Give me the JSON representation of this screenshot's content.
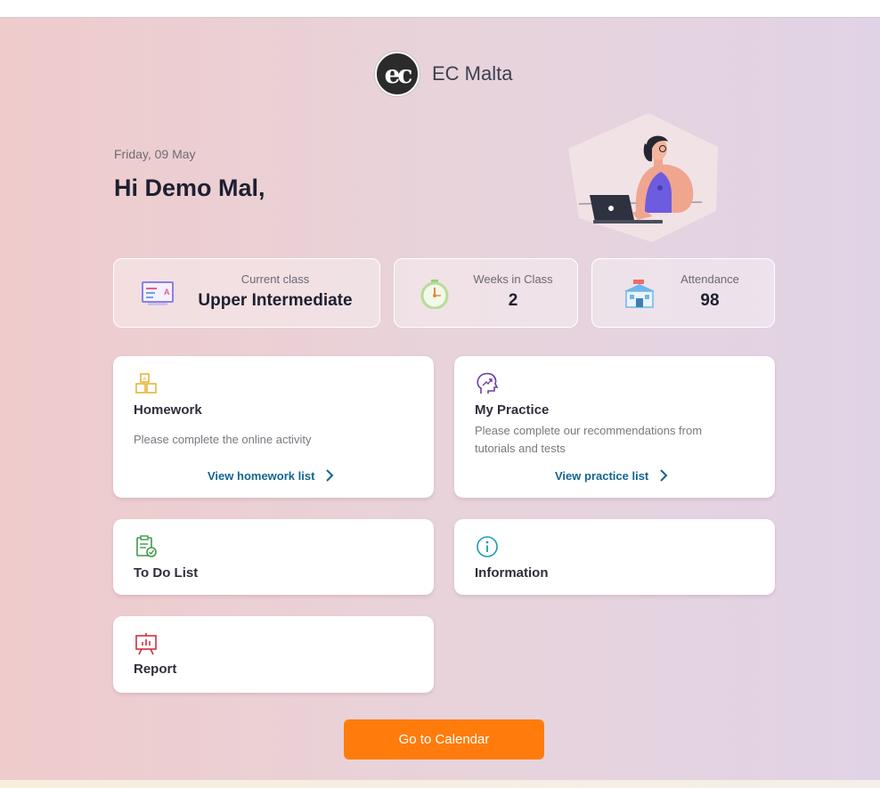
{
  "brand": {
    "name": "EC Malta",
    "logo_text": "ec"
  },
  "header": {
    "date": "Friday, 09 May",
    "greeting": "Hi Demo Mal,"
  },
  "stats": {
    "current_class": {
      "label": "Current class",
      "value": "Upper Intermediate",
      "icon": "classroom-board-icon"
    },
    "weeks": {
      "label": "Weeks in Class",
      "value": "2",
      "icon": "stopwatch-icon"
    },
    "attendance": {
      "label": "Attendance",
      "value": "98",
      "icon": "school-building-icon"
    }
  },
  "tiles": {
    "homework": {
      "title": "Homework",
      "description": "Please complete the online activity",
      "link": "View homework list",
      "icon": "blocks-icon"
    },
    "practice": {
      "title": "My Practice",
      "description": "Please complete our recommendations from tutorials and tests",
      "link": "View practice list",
      "icon": "head-growth-icon"
    },
    "todo": {
      "title": "To Do List",
      "icon": "clipboard-check-icon"
    },
    "information": {
      "title": "Information",
      "icon": "info-circle-icon"
    },
    "report": {
      "title": "Report",
      "icon": "presentation-chart-icon"
    }
  },
  "actions": {
    "calendar_button": "Go to Calendar"
  },
  "colors": {
    "accent_orange": "#ff7c0c",
    "link_blue": "#13658f",
    "heading_dark": "#1d2030",
    "homework_icon": "#e5b53b",
    "practice_icon": "#6b3fa0",
    "todo_icon": "#3d9a4a",
    "info_icon": "#1a9bb8",
    "report_icon": "#d0303a"
  }
}
